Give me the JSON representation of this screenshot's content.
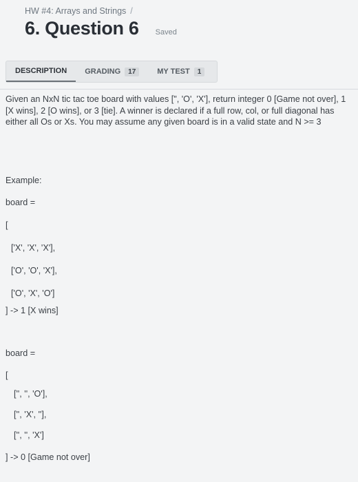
{
  "breadcrumb": {
    "text": "HW #4: Arrays and Strings",
    "separator": "/"
  },
  "title": "6. Question 6",
  "status": "Saved",
  "tabs": [
    {
      "label": "DESCRIPTION",
      "badge": ""
    },
    {
      "label": "GRADING",
      "badge": "17"
    },
    {
      "label": "MY TEST",
      "badge": "1"
    }
  ],
  "description": "Given an NxN tic tac toe board with values [\", 'O', 'X'], return integer 0 [Game not over], 1 [X wins], 2 [O wins], or 3 [tie]. A winner is declared if a full row, col, or full diagonal has either all Os or Xs. You may assume any given board is in a valid state and N >= 3",
  "example": {
    "heading": "Example:",
    "board1_label": "board =",
    "board1_open": "[",
    "board1_rows": [
      "['X', 'X', 'X'],",
      "['O', 'O', 'X'],",
      "['O', 'X', 'O']"
    ],
    "board1_result": "] -> 1 [X wins]",
    "board2_label": "board =",
    "board2_open": "[",
    "board2_rows": [
      "['', '', 'O'],",
      "['', 'X', ''],",
      "['', '', 'X']"
    ],
    "board2_result": "] -> 0 [Game not over]"
  }
}
